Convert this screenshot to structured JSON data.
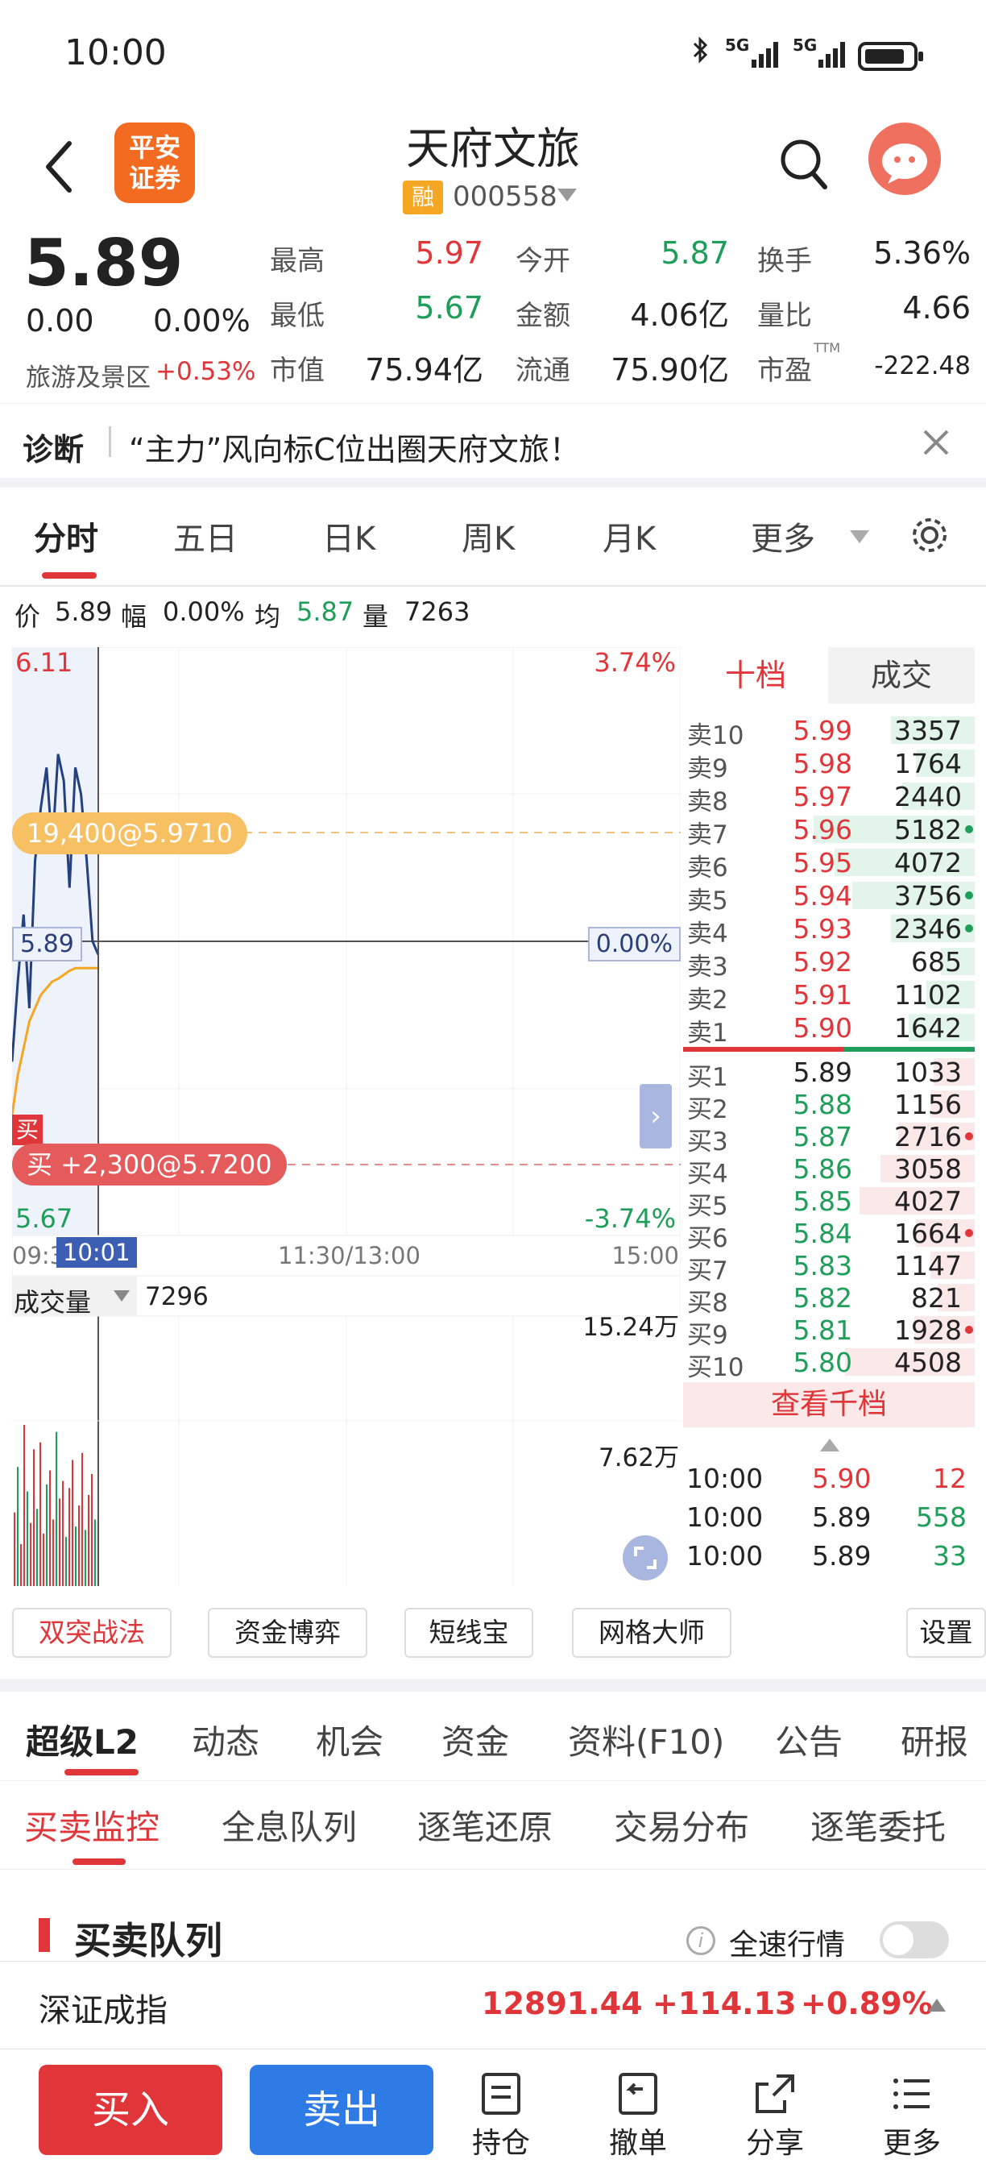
{
  "status_bar": {
    "time": "10:00",
    "signal1": "5G",
    "signal2": "5G"
  },
  "header": {
    "logo_text": "平安\n证券",
    "stock_name": "天府文旅",
    "margin_badge": "融",
    "stock_code": "000558"
  },
  "quote": {
    "price": "5.89",
    "change": "0.00",
    "change_pct": "0.00%",
    "sector_name": "旅游及景区",
    "sector_pct": "+0.53%",
    "cells": [
      {
        "label": "最高",
        "value": "5.97",
        "color": "red"
      },
      {
        "label": "今开",
        "value": "5.87",
        "color": "green"
      },
      {
        "label": "换手",
        "value": "5.36%",
        "color": "dark"
      },
      {
        "label": "最低",
        "value": "5.67",
        "color": "green"
      },
      {
        "label": "金额",
        "value": "4.06亿",
        "color": "dark"
      },
      {
        "label": "量比",
        "value": "4.66",
        "color": "dark"
      },
      {
        "label": "市值",
        "value": "75.94亿",
        "color": "dark"
      },
      {
        "label": "流通",
        "value": "75.90亿",
        "color": "dark"
      },
      {
        "label": "市盈",
        "value": "-222.48",
        "color": "dark",
        "sup": "TTM"
      }
    ]
  },
  "diagnosis": {
    "label": "诊断",
    "text": "“主力”风向标C位出圈天府文旅！"
  },
  "chart_tabs": [
    "分时",
    "五日",
    "日K",
    "周K",
    "月K",
    "更多"
  ],
  "info_line": {
    "price_label": "价",
    "price": "5.89",
    "range_label": "幅",
    "range": "0.00%",
    "avg_label": "均",
    "avg": "5.87",
    "vol_label": "量",
    "vol": "7263"
  },
  "chart": {
    "y_top": "6.11",
    "y_top_pct": "3.74%",
    "y_bottom": "5.67",
    "y_bottom_pct": "-3.74%",
    "current_price": "5.89",
    "zero_pct": "0.00%",
    "sell_marker": "19,400@5.9710",
    "buy_marker": "买 +2,300@5.7200",
    "buy_tag": "买",
    "time_start": "09:3",
    "time_cursor": "10:01",
    "time_mid": "11:30/13:00",
    "time_end": "15:00",
    "volume_label": "成交量",
    "volume_value": "7296",
    "vol_top": "15.24万",
    "vol_mid": "7.62万"
  },
  "chart_data": {
    "type": "line",
    "title": "分时",
    "ylim": [
      5.67,
      6.11
    ],
    "series": [
      {
        "name": "价",
        "values": [
          5.8,
          5.86,
          5.91,
          5.84,
          5.95,
          5.99,
          6.02,
          5.96,
          6.03,
          6.01,
          5.93,
          6.02,
          6.0,
          5.95,
          5.89,
          5.88
        ]
      },
      {
        "name": "均",
        "values": [
          5.76,
          5.79,
          5.81,
          5.83,
          5.84,
          5.85,
          5.855,
          5.86,
          5.862,
          5.865,
          5.868,
          5.87,
          5.87,
          5.87,
          5.87,
          5.87
        ]
      }
    ],
    "volume": [
      2.1,
      3.4,
      1.2,
      4.6,
      2.7,
      1.8,
      3.9,
      2.2,
      4.1,
      1.5,
      2.9,
      3.3,
      1.9,
      4.4,
      2.5,
      3.0,
      1.4,
      2.8,
      3.6,
      1.7,
      2.3,
      3.8,
      1.6,
      2.6,
      3.2,
      1.9
    ]
  },
  "book": {
    "tab_depth": "十档",
    "tab_trades": "成交",
    "asks": [
      {
        "label": "卖10",
        "price": "5.99",
        "vol": "3357",
        "bar": 0.38,
        "dot": ""
      },
      {
        "label": "卖9",
        "price": "5.98",
        "vol": "1764",
        "bar": 0.24,
        "dot": ""
      },
      {
        "label": "卖8",
        "price": "5.97",
        "vol": "2440",
        "bar": 0.32,
        "dot": ""
      },
      {
        "label": "卖7",
        "price": "5.96",
        "vol": "5182",
        "bar": 0.82,
        "dot": "green"
      },
      {
        "label": "卖6",
        "price": "5.95",
        "vol": "4072",
        "bar": 0.7,
        "dot": ""
      },
      {
        "label": "卖5",
        "price": "5.94",
        "vol": "3756",
        "bar": 0.6,
        "dot": "green"
      },
      {
        "label": "卖4",
        "price": "5.93",
        "vol": "2346",
        "bar": 0.38,
        "dot": "green"
      },
      {
        "label": "卖3",
        "price": "5.92",
        "vol": "685",
        "bar": 0.1,
        "dot": ""
      },
      {
        "label": "卖2",
        "price": "5.91",
        "vol": "1102",
        "bar": 0.18,
        "dot": ""
      },
      {
        "label": "卖1",
        "price": "5.90",
        "vol": "1642",
        "bar": 0.28,
        "dot": ""
      }
    ],
    "bids": [
      {
        "label": "买1",
        "price": "5.89",
        "vol": "1033",
        "color": "dark",
        "bar": 0.14,
        "dot": ""
      },
      {
        "label": "买2",
        "price": "5.88",
        "vol": "1156",
        "color": "green",
        "bar": 0.16,
        "dot": ""
      },
      {
        "label": "买3",
        "price": "5.87",
        "vol": "2716",
        "color": "green",
        "bar": 0.34,
        "dot": "red"
      },
      {
        "label": "买4",
        "price": "5.86",
        "vol": "3058",
        "color": "green",
        "bar": 0.44,
        "dot": ""
      },
      {
        "label": "买5",
        "price": "5.85",
        "vol": "4027",
        "color": "green",
        "bar": 0.56,
        "dot": ""
      },
      {
        "label": "买6",
        "price": "5.84",
        "vol": "1664",
        "color": "green",
        "bar": 0.24,
        "dot": "red"
      },
      {
        "label": "买7",
        "price": "5.83",
        "vol": "1147",
        "color": "green",
        "bar": 0.16,
        "dot": ""
      },
      {
        "label": "买8",
        "price": "5.82",
        "vol": "821",
        "color": "green",
        "bar": 0.12,
        "dot": ""
      },
      {
        "label": "买9",
        "price": "5.81",
        "vol": "1928",
        "color": "green",
        "bar": 0.25,
        "dot": "red"
      },
      {
        "label": "买10",
        "price": "5.80",
        "vol": "4508",
        "color": "green",
        "bar": 0.64,
        "dot": ""
      }
    ],
    "view_more": "查看千档",
    "trades": [
      {
        "time": "10:00",
        "price": "5.90",
        "price_color": "red",
        "vol": "12",
        "vol_color": "red"
      },
      {
        "time": "10:00",
        "price": "5.89",
        "price_color": "dark",
        "vol": "558",
        "vol_color": "green"
      },
      {
        "time": "10:00",
        "price": "5.89",
        "price_color": "dark",
        "vol": "33",
        "vol_color": "green"
      }
    ]
  },
  "tools": [
    "双突战法",
    "资金博弈",
    "短线宝",
    "网格大师",
    "设置"
  ],
  "l2_tabs": [
    "超级L2",
    "动态",
    "机会",
    "资金",
    "资料(F10)",
    "公告",
    "研报"
  ],
  "sub_tabs": [
    "买卖监控",
    "全息队列",
    "逐笔还原",
    "交易分布",
    "逐笔委托"
  ],
  "queue": {
    "title": "买卖队列",
    "fast_label": "全速行情"
  },
  "index": {
    "name": "深证成指",
    "value": "12891.44",
    "change": "+114.13",
    "pct": "+0.89%"
  },
  "bottom_nav": {
    "buy": "买入",
    "sell": "卖出",
    "items": [
      "持仓",
      "撤单",
      "分享",
      "更多"
    ]
  }
}
